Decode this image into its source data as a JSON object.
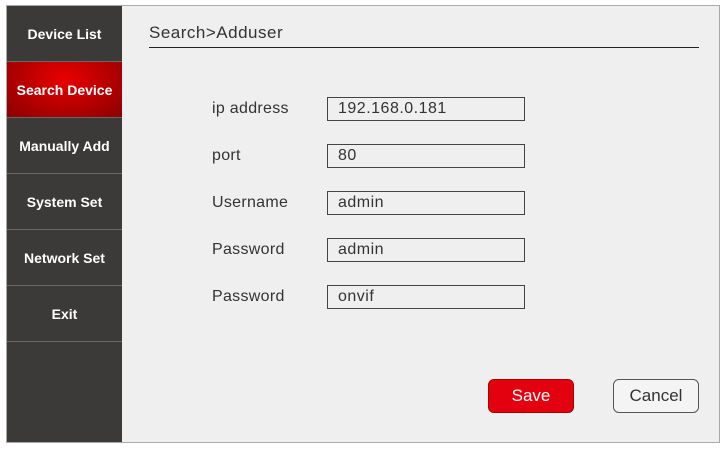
{
  "sidebar": {
    "items": [
      {
        "label": "Device List"
      },
      {
        "label": "Search Device",
        "active": true
      },
      {
        "label": "Manually Add"
      },
      {
        "label": "System Set"
      },
      {
        "label": "Network Set"
      },
      {
        "label": "Exit"
      }
    ]
  },
  "header": {
    "title": "Search>Adduser"
  },
  "form": {
    "fields": [
      {
        "label": "ip address",
        "value": "192.168.0.181"
      },
      {
        "label": "port",
        "value": "80"
      },
      {
        "label": "Username",
        "value": "admin"
      },
      {
        "label": "Password",
        "value": "admin"
      },
      {
        "label": "Password",
        "value": "onvif"
      }
    ]
  },
  "buttons": {
    "save": "Save",
    "cancel": "Cancel"
  },
  "colors": {
    "accent": "#e3000f",
    "sidebar": "#3c3a38"
  }
}
